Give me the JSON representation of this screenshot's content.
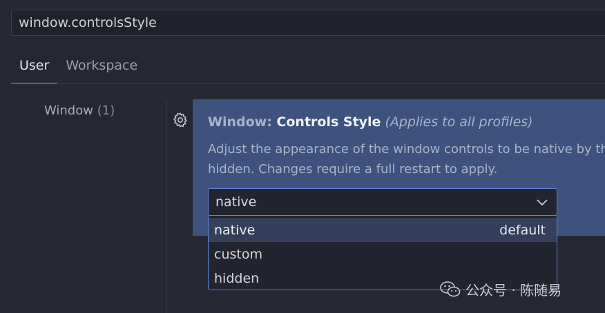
{
  "search": {
    "value": "window.controlsStyle"
  },
  "tabs": [
    {
      "label": "User",
      "active": true
    },
    {
      "label": "Workspace",
      "active": false
    }
  ],
  "toc": {
    "label": "Window",
    "count": "(1)"
  },
  "setting": {
    "category": "Window: ",
    "name": "Controls Style",
    "scope": "(Applies to all profiles)",
    "description_line1": "Adjust the appearance of the window controls to be native by th",
    "description_line2": "hidden. Changes require a full restart to apply.",
    "current_value": "native",
    "options": [
      {
        "label": "native",
        "badge": "default",
        "selected": true
      },
      {
        "label": "custom",
        "badge": "",
        "selected": false
      },
      {
        "label": "hidden",
        "badge": "",
        "selected": false
      }
    ]
  },
  "watermark": {
    "text": "公众号 · 陈随易"
  },
  "icons": {
    "gear": "gear-icon",
    "chevron": "chevron-down-icon",
    "wechat": "wechat-icon"
  },
  "colors": {
    "background": "#252833",
    "panel": "#3d537e",
    "accent_border": "#5a84d8",
    "tab_underline": "#7aa6ff"
  }
}
